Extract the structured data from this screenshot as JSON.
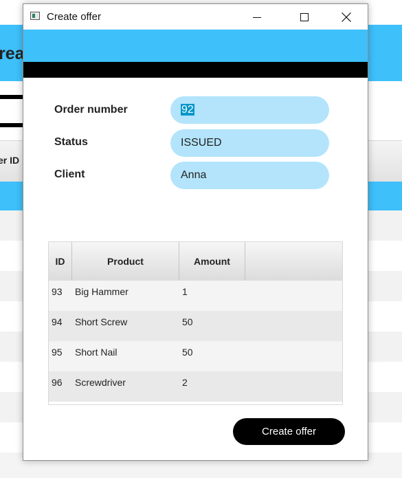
{
  "background": {
    "title_fragment": "rea",
    "table_header_fragment": "er ID"
  },
  "dialog": {
    "title": "Create offer",
    "icons": {
      "app": "app-window-icon",
      "minimize": "minimize-icon",
      "maximize": "maximize-icon",
      "close": "close-icon"
    }
  },
  "form": {
    "order_number": {
      "label": "Order number",
      "value": "92"
    },
    "status": {
      "label": "Status",
      "value": "ISSUED"
    },
    "client": {
      "label": "Client",
      "value": "Anna"
    }
  },
  "table": {
    "columns": [
      "ID",
      "Product",
      "Amount"
    ],
    "rows": [
      {
        "id": "93",
        "product": "Big Hammer",
        "amount": "1"
      },
      {
        "id": "94",
        "product": "Short Screw",
        "amount": "50"
      },
      {
        "id": "95",
        "product": "Short Nail",
        "amount": "50"
      },
      {
        "id": "96",
        "product": "Screwdriver",
        "amount": "2"
      }
    ]
  },
  "actions": {
    "create_offer": "Create offer"
  },
  "colors": {
    "accent": "#3ec0fb",
    "field": "#b3e4fb",
    "selection": "#0096c9",
    "button": "#000000"
  }
}
